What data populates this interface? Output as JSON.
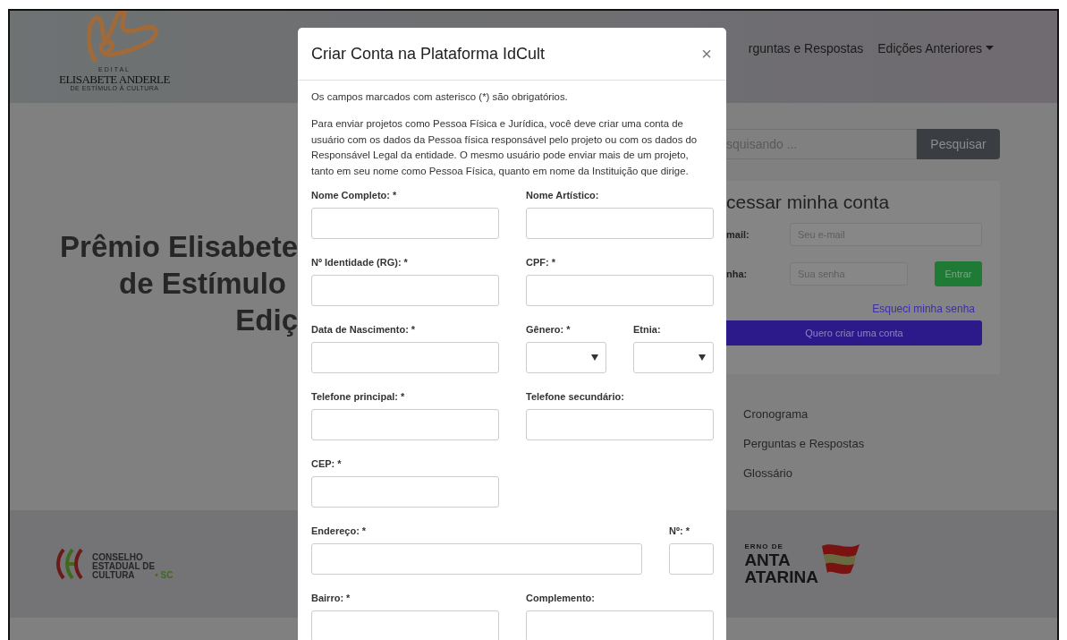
{
  "header": {
    "logo": {
      "top": "EDITAL",
      "name": "ELISABETE ANDERLE",
      "sub": "DE ESTÍMULO À CULTURA"
    },
    "nav": [
      {
        "label": "rguntas e Respostas",
        "dropdown": false
      },
      {
        "label": "Edições Anteriores",
        "dropdown": true
      }
    ]
  },
  "hero": {
    "lines": [
      "Prêmio Elisabete",
      "de Estímulo",
      "Ediç"
    ]
  },
  "search": {
    "placeholder": "squisando ...",
    "button": "Pesquisar"
  },
  "login": {
    "title": "cessar minha conta",
    "email_label": "mail:",
    "email_placeholder": "Seu e-mail",
    "password_label": "nha:",
    "password_placeholder": "Sua senha",
    "submit": "Entrar",
    "forgot": "Esqueci minha senha",
    "create": "Quero criar uma conta"
  },
  "links": [
    {
      "label": "Cronograma"
    },
    {
      "label": "Perguntas e Respostas"
    },
    {
      "label": "Glossário"
    }
  ],
  "footer": {
    "council_logo": [
      "CONSELHO",
      "ESTADUAL DE",
      "CULTURA"
    ],
    "council_suffix": "• SC",
    "state_logo": [
      "ERNO DE",
      "ANTA",
      "ATARINA"
    ]
  },
  "modal": {
    "title": "Criar Conta na Plataforma IdCult",
    "close": "×",
    "note": "Os campos marcados com asterisco (*) são obrigatórios.",
    "intro": "Para enviar projetos como Pessoa Física e Jurídica, você deve criar uma conta de usuário com os dados da Pessoa física responsável pelo projeto ou com os dados do Responsável Legal da entidade. O mesmo usuário pode enviar mais de um projeto, tanto em seu nome como Pessoa Física, quanto em nome da Instituição que dirige.",
    "rows": [
      [
        {
          "label": "Nome Completo: *",
          "kind": "text"
        },
        {
          "label": "Nome Artístico:",
          "kind": "text"
        }
      ],
      [
        {
          "label": "Nº Identidade (RG): *",
          "kind": "text"
        },
        {
          "label": "CPF: *",
          "kind": "text"
        }
      ],
      [
        {
          "label": "Data de Nascimento: *",
          "kind": "text"
        },
        {
          "label": "Gênero: *",
          "kind": "select"
        },
        {
          "label": "Etnia:",
          "kind": "select"
        }
      ],
      [
        {
          "label": "Telefone principal: *",
          "kind": "text"
        },
        {
          "label": "Telefone secundário:",
          "kind": "text"
        }
      ],
      [
        {
          "label": "CEP: *",
          "kind": "text"
        }
      ],
      [
        {
          "label": "Endereço: *",
          "kind": "wide"
        },
        {
          "label": "Nº: *",
          "kind": "short"
        }
      ],
      [
        {
          "label": "Bairro: *",
          "kind": "text"
        },
        {
          "label": "Complemento:",
          "kind": "text"
        }
      ]
    ]
  }
}
